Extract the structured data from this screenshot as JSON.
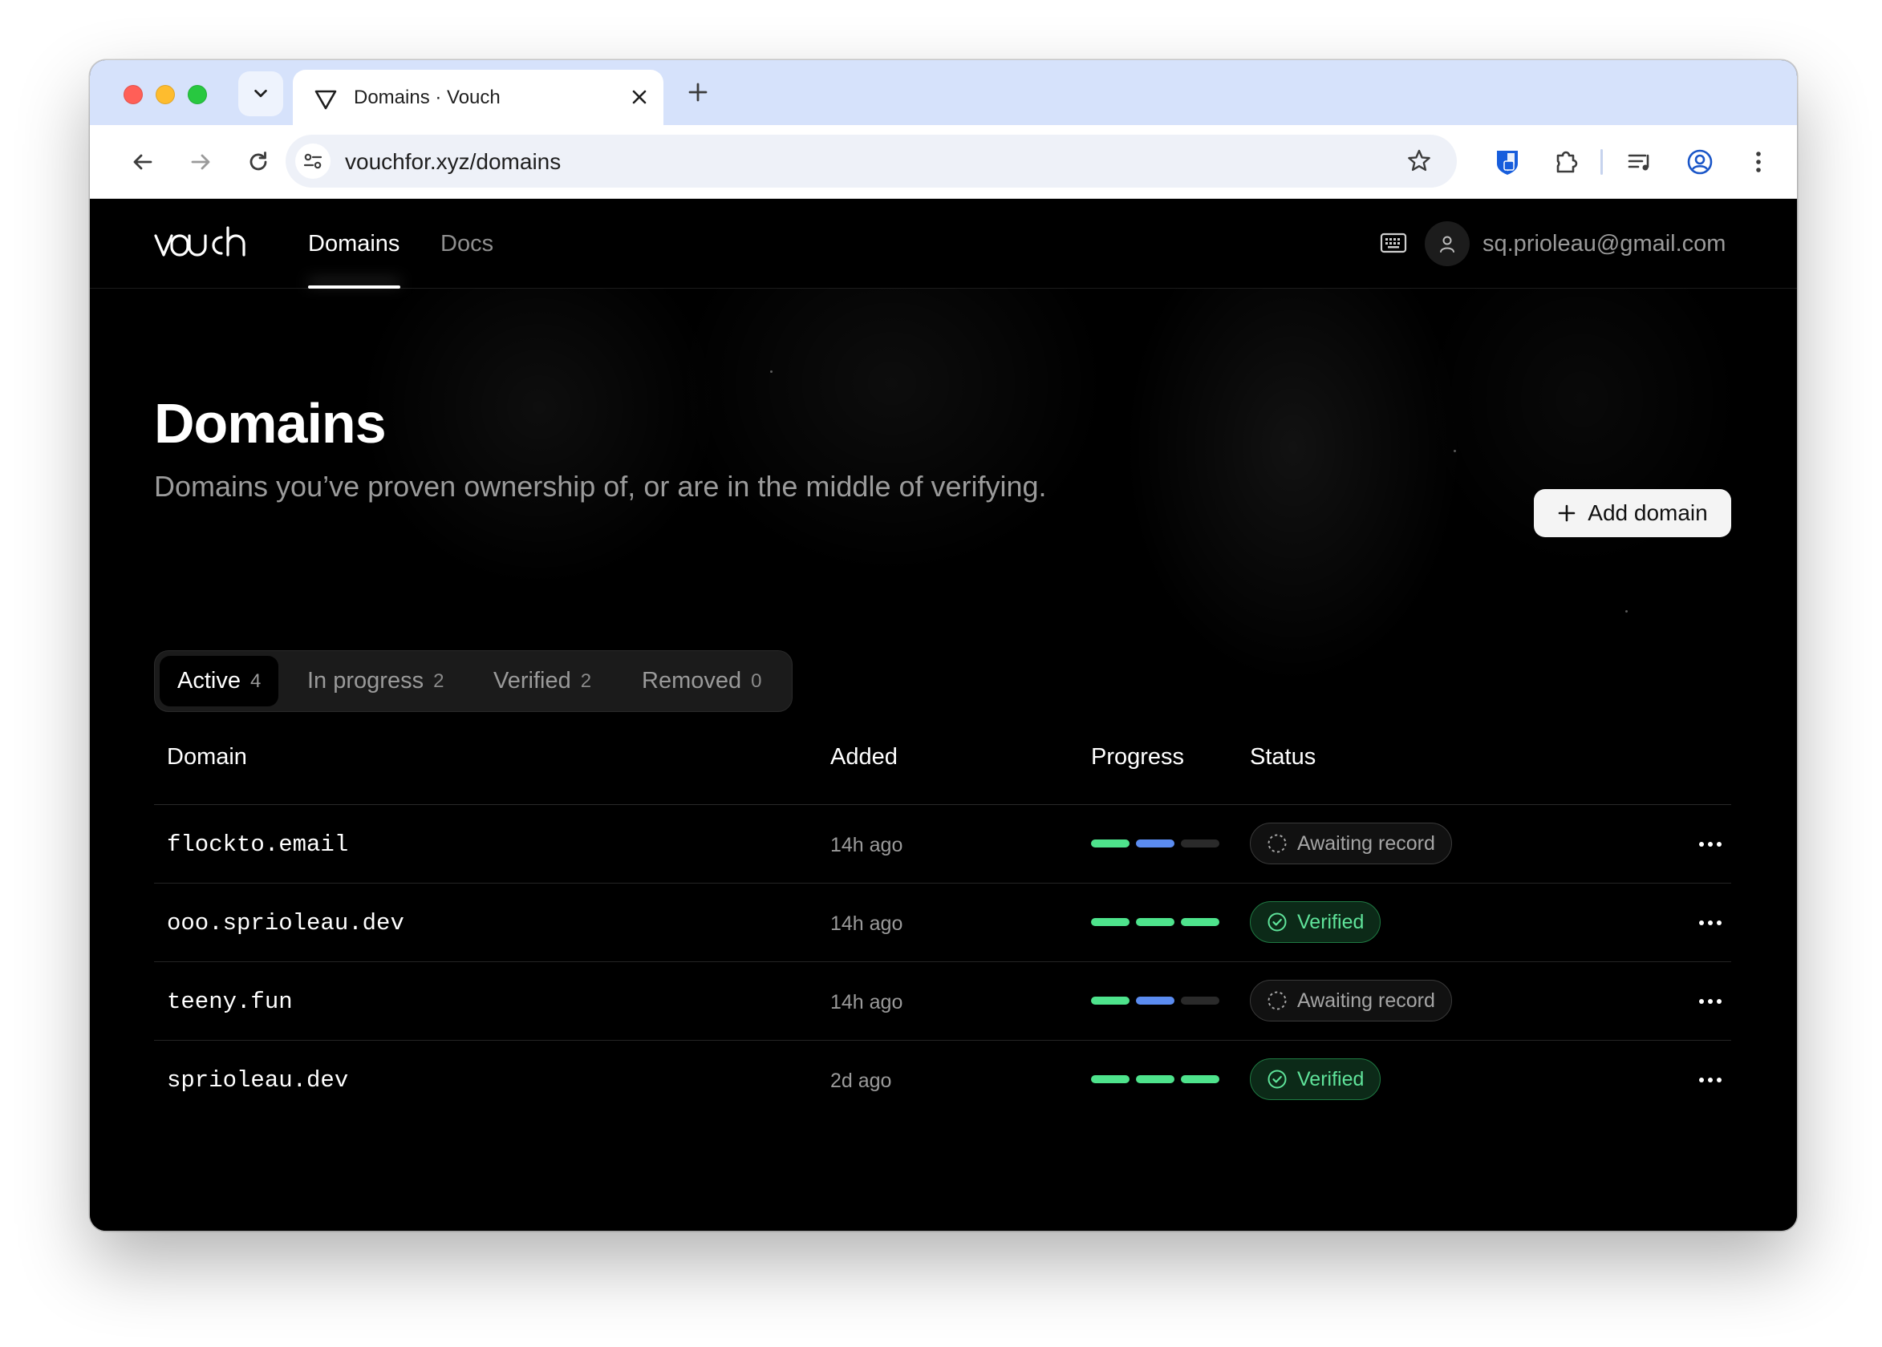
{
  "browser": {
    "tab_title": "Domains · Vouch",
    "url": "vouchfor.xyz/domains",
    "accent": "#d6e2fb"
  },
  "app": {
    "nav": {
      "domains_label": "Domains",
      "docs_label": "Docs"
    },
    "user_email": "sq.prioleau@gmail.com"
  },
  "page": {
    "title": "Domains",
    "subtitle": "Domains you’ve proven ownership of, or are in the middle of verifying.",
    "add_button_label": "Add domain"
  },
  "filters": [
    {
      "label": "Active",
      "count": "4",
      "active": true
    },
    {
      "label": "In progress",
      "count": "2",
      "active": false
    },
    {
      "label": "Verified",
      "count": "2",
      "active": false
    },
    {
      "label": "Removed",
      "count": "0",
      "active": false
    }
  ],
  "table": {
    "headers": {
      "domain": "Domain",
      "added": "Added",
      "progress": "Progress",
      "status": "Status"
    },
    "rows": [
      {
        "domain": "flockto.email",
        "added": "14h ago",
        "steps_complete": 1,
        "steps_current": 1,
        "steps_total": 3,
        "status": "Awaiting record",
        "status_kind": "awaiting"
      },
      {
        "domain": "ooo.sprioleau.dev",
        "added": "14h ago",
        "steps_complete": 3,
        "steps_current": 0,
        "steps_total": 3,
        "status": "Verified",
        "status_kind": "verified"
      },
      {
        "domain": "teeny.fun",
        "added": "14h ago",
        "steps_complete": 1,
        "steps_current": 1,
        "steps_total": 3,
        "status": "Awaiting record",
        "status_kind": "awaiting"
      },
      {
        "domain": "sprioleau.dev",
        "added": "2d ago",
        "steps_complete": 3,
        "steps_current": 0,
        "steps_total": 3,
        "status": "Verified",
        "status_kind": "verified"
      }
    ]
  },
  "colors": {
    "progress_done": "#4ee38c",
    "progress_current": "#5b8cf0",
    "progress_pending": "#2a2a2a",
    "verified_text": "#5fe39a"
  },
  "icons": [
    "chevron-down-icon",
    "vouch-favicon-icon",
    "close-icon",
    "plus-icon",
    "back-arrow-icon",
    "forward-arrow-icon",
    "reload-icon",
    "site-settings-icon",
    "bookmark-star-icon",
    "extension-bitwarden-icon",
    "puzzle-extensions-icon",
    "reading-list-icon",
    "profile-icon",
    "kebab-menu-icon",
    "keyboard-icon",
    "user-icon",
    "dashed-circle-icon",
    "check-circle-icon",
    "ellipsis-icon"
  ]
}
